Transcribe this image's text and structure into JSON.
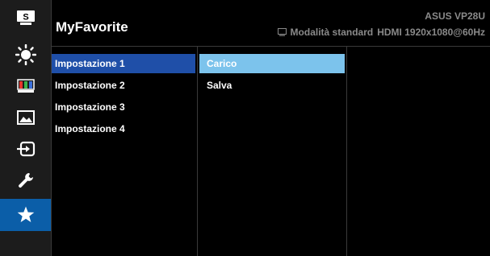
{
  "sidebar": {
    "items": [
      {
        "name": "splendid-icon",
        "label": "S"
      },
      {
        "name": "brightness-icon"
      },
      {
        "name": "color-icon"
      },
      {
        "name": "image-icon"
      },
      {
        "name": "input-select-icon"
      },
      {
        "name": "system-setup-icon"
      },
      {
        "name": "myfavorite-star-icon",
        "active": true
      }
    ]
  },
  "header": {
    "title": "MyFavorite",
    "model": "ASUS  VP28U",
    "status_mode": "Modalità standard",
    "status_signal": "HDMI 1920x1080@60Hz"
  },
  "menu": {
    "settings": [
      "Impostazione 1",
      "Impostazione 2",
      "Impostazione 3",
      "Impostazione 4"
    ],
    "selected_setting": "Impostazione 1",
    "actions": [
      "Carico",
      "Salva"
    ],
    "highlighted_action": "Carico"
  },
  "colors": {
    "background": "#000000",
    "sidebar": "#1c1c1c",
    "active_sidebar": "#0b5ea8",
    "selected_row": "#1f4fa8",
    "highlighted_row": "#7cc3ec",
    "muted_text": "#8a8a8a"
  }
}
